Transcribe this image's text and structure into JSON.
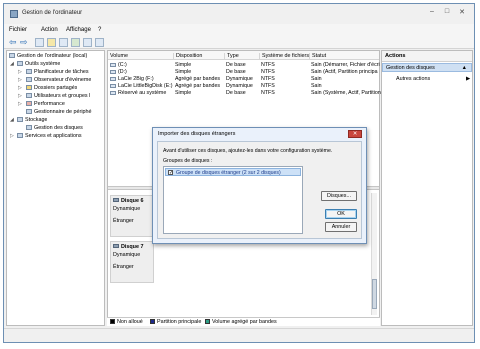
{
  "window": {
    "title": "Gestion de l'ordinateur",
    "controls": {
      "minimize": "–",
      "maximize": "□",
      "close": "✕"
    }
  },
  "menu": [
    "Fichier",
    "Action",
    "Affichage",
    "?"
  ],
  "toolbar": {
    "icons": [
      "back-icon",
      "forward-icon",
      "up-icon",
      "console-tree-icon",
      "properties-icon",
      "help-icon",
      "list-icon",
      "export-icon"
    ],
    "back": "⇦",
    "forward": "⇨"
  },
  "tree": {
    "root": "Gestion de l'ordinateur (local)",
    "items": [
      "Outils système",
      "Planificateur de tâches",
      "Observateur d'événeme",
      "Dossiers partagés",
      "Utilisateurs et groupes l",
      "Performance",
      "Gestionnaire de périphé",
      "Stockage",
      "Gestion des disques",
      "Services et applications"
    ]
  },
  "columns": [
    "Volume",
    "Disposition",
    "Type",
    "Système de fichiers",
    "Statut"
  ],
  "volumes": [
    [
      "(C:)",
      "Simple",
      "De base",
      "NTFS",
      "Sain (Démarrer, Fichier d'écri"
    ],
    [
      "(D:)",
      "Simple",
      "De base",
      "NTFS",
      "Sain (Actif, Partition principa"
    ],
    [
      "LaCie 2Big (F:)",
      "Agrégé par bandes",
      "Dynamique",
      "NTFS",
      "Sain"
    ],
    [
      "LaCie LittleBigDisk (E:)",
      "Agrégé par bandes",
      "Dynamique",
      "NTFS",
      "Sain"
    ],
    [
      "Réservé au système",
      "Simple",
      "De base",
      "NTFS",
      "Sain (Système, Actif, Partition"
    ]
  ],
  "disks": [
    {
      "name": "Disque 6",
      "type": "Dynamique",
      "state": "Étranger"
    },
    {
      "name": "Disque 7",
      "type": "Dynamique",
      "state": "Étranger"
    }
  ],
  "legend": [
    {
      "label": "Non alloué",
      "color": "#000000"
    },
    {
      "label": "Partition principale",
      "color": "#1c2a8c"
    },
    {
      "label": "Volume agrégé par bandes",
      "color": "#2e9e86"
    }
  ],
  "actions": {
    "header": "Actions",
    "selected": "Gestion des disques",
    "item": "Autres actions",
    "arrow_up": "▲",
    "arrow_right": "▶"
  },
  "dialog": {
    "title": "Importer des disques étrangers",
    "close": "✕",
    "instruction": "Avant d'utiliser ces disques, ajoutez-les dans votre configuration système.",
    "group_label": "Groupes de disques :",
    "groups": [
      "Groupe de disques étranger (2 sur 2 disques)"
    ],
    "checkmark": "✓",
    "buttons": {
      "disks": "Disques...",
      "ok": "OK",
      "cancel": "Annuler"
    }
  },
  "colors": {
    "accent": "#cfe0f3",
    "selection_border": "#9bbbe0",
    "dialog_frame": "#6e8fb5"
  }
}
